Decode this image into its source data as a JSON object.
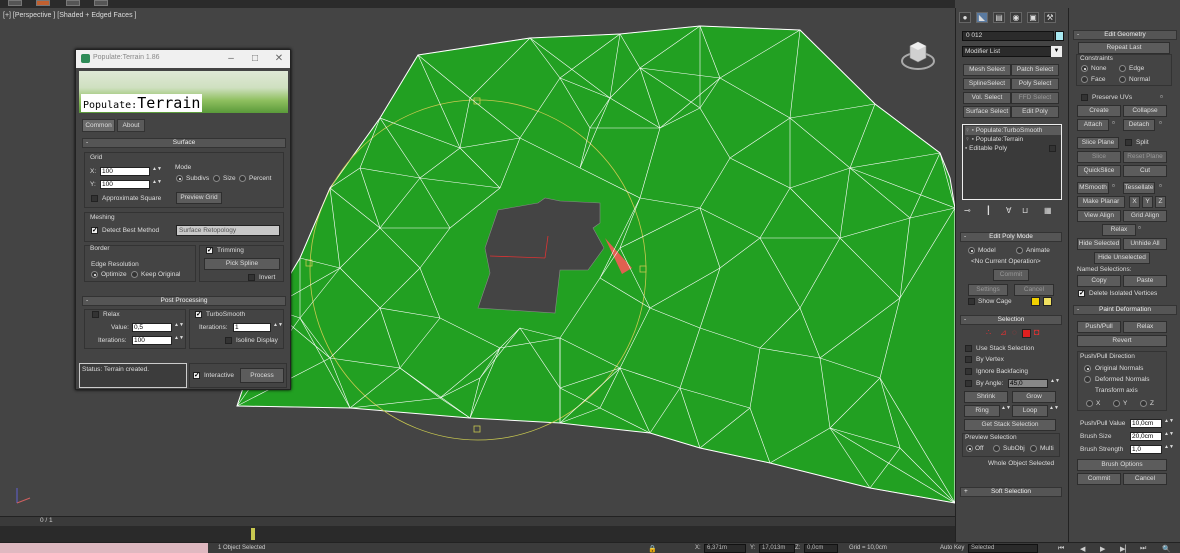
{
  "viewport": {
    "label": "[+] [Perspective ] [Shaded + Edged Faces ]",
    "terrain_color": "#22a022",
    "wire_color": "#ffffff",
    "background": "#444444"
  },
  "dialog": {
    "title": "Populate:Terrain 1.86",
    "banner_small": "Populate:",
    "banner_big": "Terrain",
    "tabs": [
      "Common",
      "About"
    ],
    "surface": {
      "header": "Surface",
      "grid_label": "Grid",
      "x_label": "X:",
      "x_value": "100",
      "y_label": "Y:",
      "y_value": "100",
      "mode_label": "Mode",
      "mode_options": [
        "Subdivs",
        "Size",
        "Percent"
      ],
      "approx_square": "Approximate Square",
      "preview_grid": "Preview Grid",
      "meshing_label": "Meshing",
      "detect_best": "Detect Best Method",
      "method_value": "Surface Retopology",
      "border_label": "Border",
      "edge_resolution": "Edge Resolution",
      "edge_options": [
        "Optimize",
        "Keep Original"
      ],
      "trimming": "Trimming",
      "pick_spline": "Pick Spline",
      "invert": "Invert"
    },
    "post": {
      "header": "Post Processing",
      "relax": "Relax",
      "value_label": "Value:",
      "value": "0,5",
      "iterations_label": "Iterations:",
      "relax_iterations": "100",
      "turbosmooth": "TurboSmooth",
      "ts_iterations": "1",
      "isoline": "Isoline Display"
    },
    "status": "Status: Terrain created.",
    "interactive": "Interactive",
    "process": "Process"
  },
  "cmd": {
    "object_name": "0  012",
    "object_color": "#a8e8f0",
    "modifier_list": "Modifier List",
    "mod_buttons": [
      "Mesh Select",
      "Patch Select",
      "SplineSelect",
      "Poly Select",
      "Vol. Select",
      "FFD Select",
      "Surface Select",
      "Edit Poly"
    ],
    "stack": [
      "Populate:TurboSmooth",
      "Populate:Terrain",
      "Editable Poly"
    ],
    "edit_poly_mode": {
      "header": "Edit Poly Mode",
      "model": "Model",
      "animate": "Animate",
      "no_op": "<No Current Operation>",
      "commit": "Commit",
      "settings": "Settings",
      "cancel": "Cancel",
      "show_cage": "Show Cage"
    },
    "selection": {
      "header": "Selection",
      "use_stack": "Use Stack Selection",
      "by_vertex": "By Vertex",
      "ignore_backfacing": "Ignore Backfacing",
      "by_angle": "By Angle:",
      "angle_value": "45,0",
      "shrink": "Shrink",
      "grow": "Grow",
      "ring": "Ring",
      "loop": "Loop",
      "get_stack": "Get Stack Selection",
      "preview_label": "Preview Selection",
      "preview_options": [
        "Off",
        "SubObj",
        "Multi"
      ],
      "whole_object": "Whole Object Selected"
    },
    "soft_selection": "Soft Selection",
    "edit_geometry": {
      "header": "Edit Geometry",
      "repeat_last": "Repeat Last",
      "constraints": "Constraints",
      "constraint_options": [
        "None",
        "Edge",
        "Face",
        "Normal"
      ],
      "preserve_uvs": "Preserve UVs",
      "create": "Create",
      "collapse": "Collapse",
      "attach": "Attach",
      "detach": "Detach",
      "slice_plane": "Slice Plane",
      "split": "Split",
      "slice": "Slice",
      "reset_plane": "Reset Plane",
      "quickslice": "QuickSlice",
      "cut": "Cut",
      "msmooth": "MSmooth",
      "tessellate": "Tessellate",
      "make_planar": "Make Planar",
      "x": "X",
      "y": "Y",
      "z": "Z",
      "view_align": "View Align",
      "grid_align": "Grid Align",
      "relax": "Relax",
      "hide_selected": "Hide Selected",
      "unhide_all": "Unhide All",
      "hide_unselected": "Hide Unselected",
      "named_selections": "Named Selections:",
      "copy": "Copy",
      "paste": "Paste",
      "delete_isolated": "Delete Isolated Vertices"
    },
    "paint_deformation": {
      "header": "Paint Deformation",
      "push_pull": "Push/Pull",
      "relax": "Relax",
      "revert": "Revert",
      "direction_label": "Push/Pull Direction",
      "original_normals": "Original Normals",
      "deformed_normals": "Deformed Normals",
      "transform_axis": "Transform axis",
      "axes": [
        "X",
        "Y",
        "Z"
      ],
      "value_label": "Push/Pull Value",
      "value": "10,0cm",
      "size_label": "Brush Size",
      "size": "20,0cm",
      "strength_label": "Brush Strength",
      "strength": "1,0",
      "brush_options": "Brush Options",
      "commit": "Commit",
      "cancel": "Cancel"
    }
  },
  "bottom": {
    "frame": "0 / 1",
    "status_text": "1 Object Selected",
    "x_label": "X:",
    "x_value": "6,371m",
    "y_label": "Y:",
    "y_value": "17,013m",
    "z_label": "Z:",
    "z_value": "0,0cm",
    "grid": "Grid = 10,0cm",
    "autokey": "Auto Key",
    "selected": "Selected"
  }
}
